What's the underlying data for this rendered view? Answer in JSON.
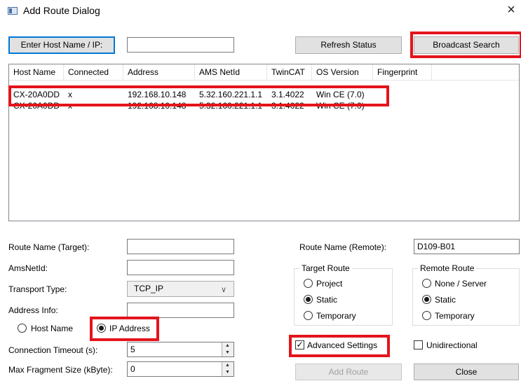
{
  "window": {
    "title": "Add Route Dialog",
    "close_glyph": "×"
  },
  "toolbar": {
    "enter_host_label": "Enter Host Name / IP:",
    "host_value": "",
    "refresh_label": "Refresh Status",
    "broadcast_label": "Broadcast Search"
  },
  "list": {
    "columns": [
      "Host Name",
      "Connected",
      "Address",
      "AMS NetId",
      "TwinCAT",
      "OS Version",
      "Fingerprint"
    ],
    "rows": [
      [
        "CX-20A0DD",
        "x",
        "192.168.10.148",
        "5.32.160.221.1.1",
        "3.1.4022",
        "Win CE (7.0)",
        ""
      ],
      [
        "CX-20A0DD",
        "x",
        "192.168.10.148",
        "5.32.160.221.1.1",
        "3.1.4022",
        "Win CE (7.0)",
        ""
      ]
    ]
  },
  "form": {
    "route_name_target_label": "Route Name (Target):",
    "route_name_target_value": "",
    "ams_netid_label": "AmsNetId:",
    "ams_netid_value": "",
    "transport_type_label": "Transport Type:",
    "transport_type_value": "TCP_IP",
    "address_info_label": "Address Info:",
    "address_info_value": "",
    "host_name_radio": "Host Name",
    "ip_address_radio": "IP Address",
    "address_mode_selected": "IP Address",
    "connection_timeout_label": "Connection Timeout (s):",
    "connection_timeout_value": "5",
    "max_fragment_label": "Max Fragment Size (kByte):",
    "max_fragment_value": "0",
    "route_name_remote_label": "Route Name (Remote):",
    "route_name_remote_value": "D109-B01"
  },
  "target_route": {
    "title": "Target Route",
    "options": [
      "Project",
      "Static",
      "Temporary"
    ],
    "selected": "Static"
  },
  "remote_route": {
    "title": "Remote Route",
    "options": [
      "None / Server",
      "Static",
      "Temporary"
    ],
    "selected": "Static"
  },
  "advanced_settings_label": "Advanced Settings",
  "advanced_settings_checked": true,
  "unidirectional_label": "Unidirectional",
  "unidirectional_checked": false,
  "buttons": {
    "add_route": "Add Route",
    "close": "Close"
  },
  "highlight_color": "#e3141b",
  "accent_color": "#0078d7"
}
